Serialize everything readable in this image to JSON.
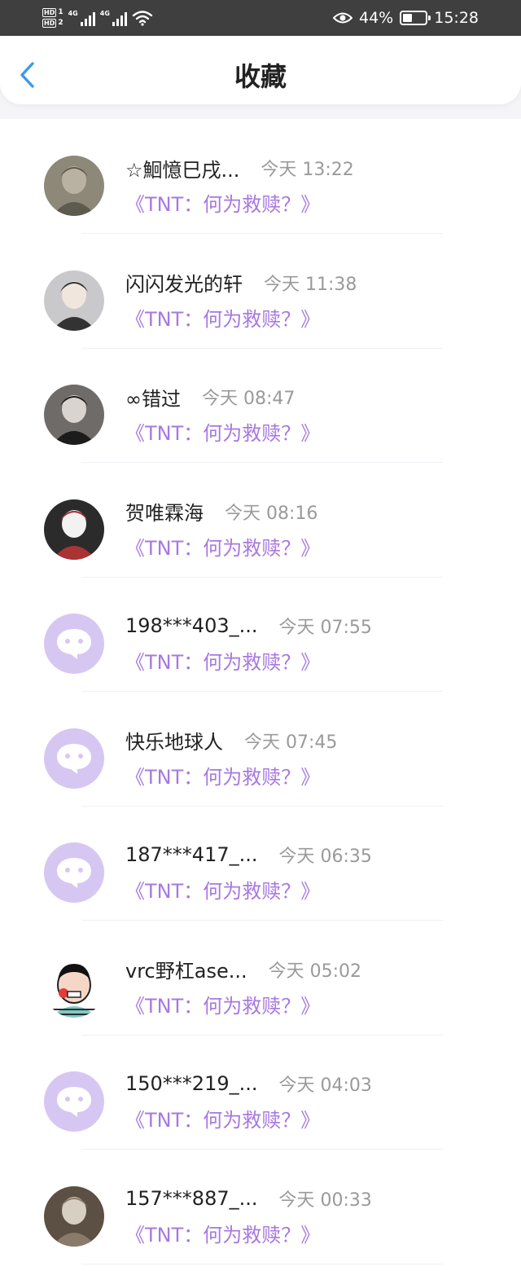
{
  "status_bar": {
    "hd1": "HD",
    "hd1_num": "1",
    "hd2": "HD",
    "hd2_num": "2",
    "net1": "4G",
    "net2": "4G",
    "battery_percent": "44%",
    "battery_level": 0.44,
    "time": "15:28"
  },
  "header": {
    "title": "收藏",
    "back_icon": "chevron-left-icon",
    "accent": "#3d9ae8"
  },
  "colors": {
    "source_text": "#a779df",
    "placeholder_avatar": "#d6c7f2",
    "time_text": "#9a9a9a"
  },
  "favorites": [
    {
      "name": "☆鮰憶巳戌...",
      "time": "今天 13:22",
      "source": "《TNT：何为救赎？》",
      "avatar": "photo"
    },
    {
      "name": "闪闪发光的轩",
      "time": "今天 11:38",
      "source": "《TNT：何为救赎？》",
      "avatar": "photo"
    },
    {
      "name": "∞错过",
      "time": "今天 08:47",
      "source": "《TNT：何为救赎？》",
      "avatar": "photo"
    },
    {
      "name": "贺唯霖海",
      "time": "今天 08:16",
      "source": "《TNT：何为救赎？》",
      "avatar": "photo"
    },
    {
      "name": "198***403_...",
      "time": "今天 07:55",
      "source": "《TNT：何为救赎？》",
      "avatar": "chat-bubble-icon"
    },
    {
      "name": "快乐地球人",
      "time": "今天 07:45",
      "source": "《TNT：何为救赎？》",
      "avatar": "chat-bubble-icon"
    },
    {
      "name": "187***417_...",
      "time": "今天 06:35",
      "source": "《TNT：何为救赎？》",
      "avatar": "chat-bubble-icon"
    },
    {
      "name": "vrc野杠ase...",
      "time": "今天 05:02",
      "source": "《TNT：何为救赎？》",
      "avatar": "cartoon"
    },
    {
      "name": "150***219_...",
      "time": "今天 04:03",
      "source": "《TNT：何为救赎？》",
      "avatar": "chat-bubble-icon"
    },
    {
      "name": "157***887_...",
      "time": "今天 00:33",
      "source": "《TNT：何为救赎？》",
      "avatar": "photo"
    }
  ]
}
